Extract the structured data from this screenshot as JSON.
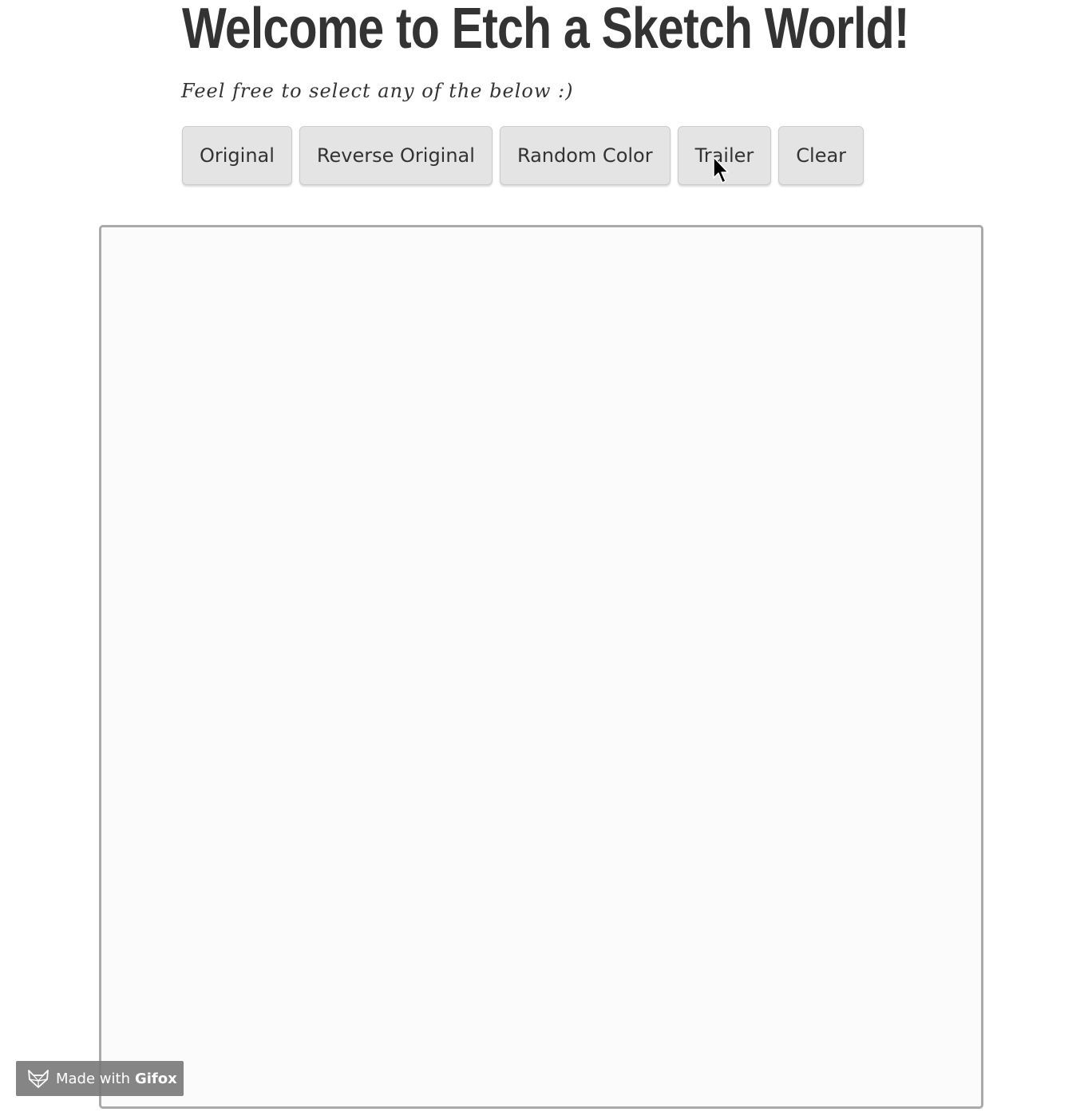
{
  "header": {
    "title": "Welcome to Etch a Sketch World!",
    "subtitle": "Feel free to select any of the below :)"
  },
  "toolbar": {
    "buttons": [
      {
        "label": "Original"
      },
      {
        "label": "Reverse Original"
      },
      {
        "label": "Random Color"
      },
      {
        "label": "Trailer"
      },
      {
        "label": "Clear"
      }
    ]
  },
  "watermark": {
    "prefix": "Made with",
    "brand": "Gifox",
    "icon": "gifox-fox-icon"
  },
  "cursor": {
    "icon": "mouse-pointer-icon"
  },
  "colors": {
    "text": "#333333",
    "button_bg": "#e4e4e4",
    "canvas_bg": "#fbfbfb",
    "canvas_border": "#aaaaaa"
  }
}
